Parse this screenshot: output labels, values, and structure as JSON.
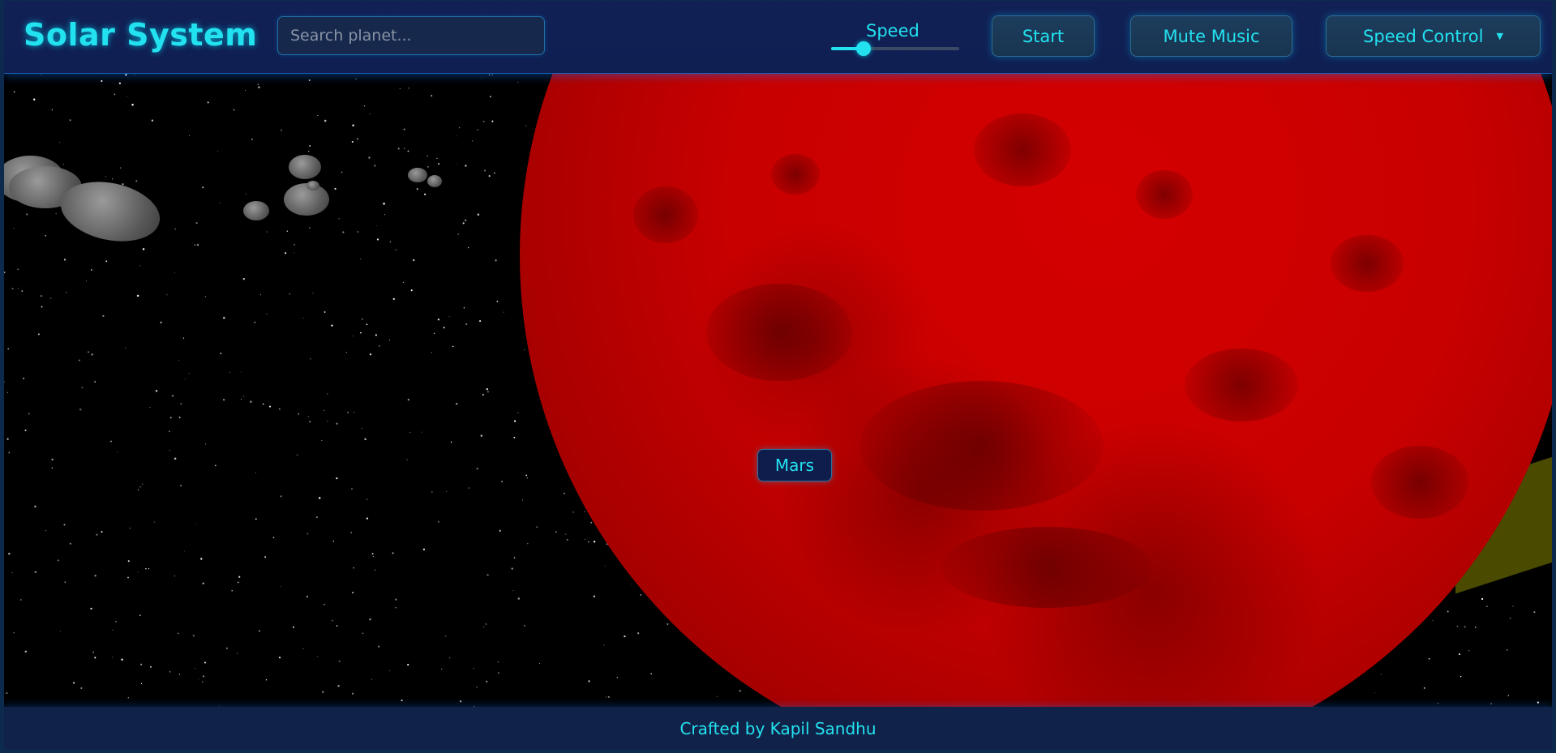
{
  "header": {
    "title": "Solar System",
    "search_placeholder": "Search planet...",
    "speed_label": "Speed",
    "speed_value": 0.25,
    "start_label": "Start",
    "mute_label": "Mute Music",
    "speed_control_label": "Speed Control"
  },
  "scene": {
    "planet_label": "Mars",
    "planet_color": "#c80000"
  },
  "footer": {
    "credit": "Crafted by Kapil Sandhu"
  },
  "colors": {
    "accent": "#23e2f0",
    "header_bg": "#112055",
    "space_bg": "#000000"
  },
  "icons": {
    "dropdown": "chevron-down-icon"
  }
}
